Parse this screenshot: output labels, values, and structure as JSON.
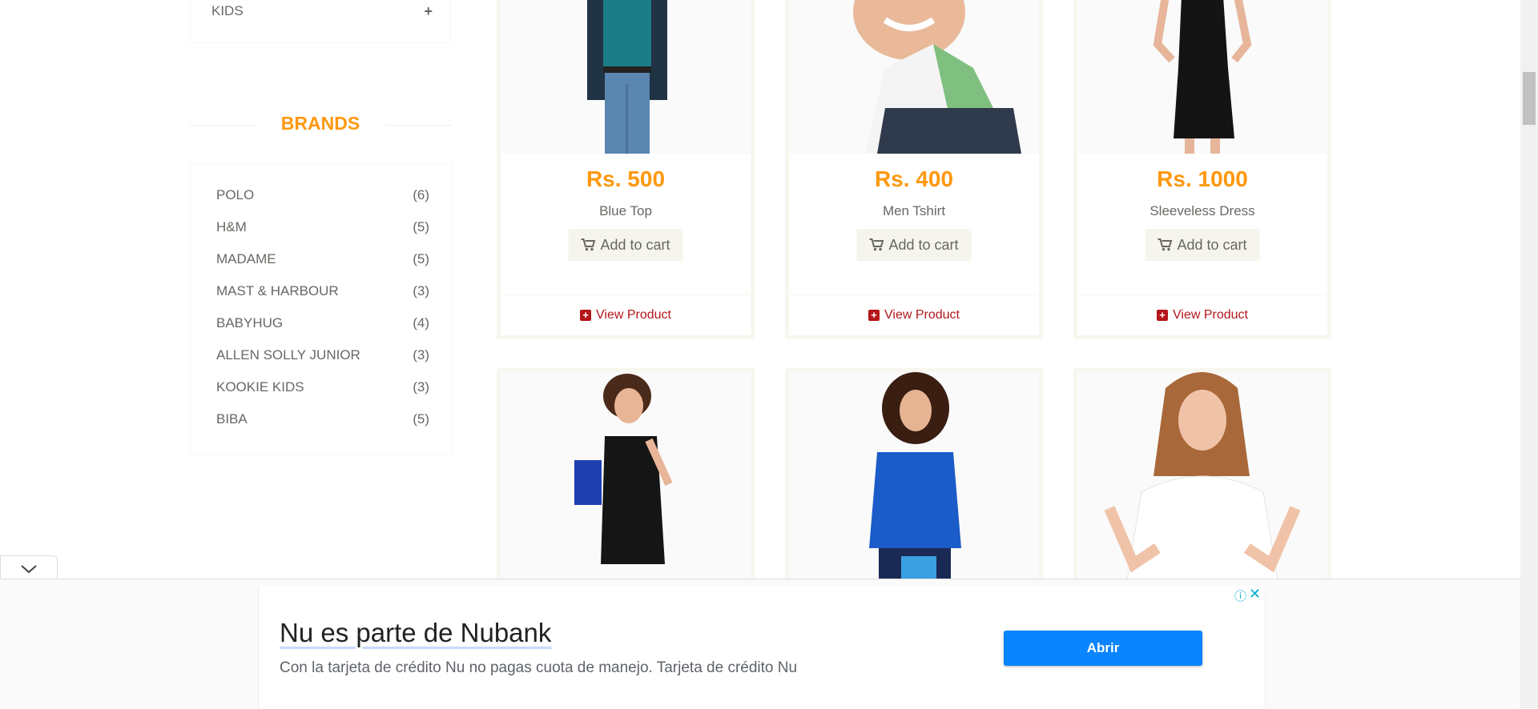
{
  "sidebar": {
    "category": {
      "label": "KIDS",
      "toggle": "+"
    },
    "brands_title": "BRANDS",
    "brands": [
      {
        "name": "POLO",
        "count": "(6)"
      },
      {
        "name": "H&M",
        "count": "(5)"
      },
      {
        "name": "MADAME",
        "count": "(5)"
      },
      {
        "name": "MAST & HARBOUR",
        "count": "(3)"
      },
      {
        "name": "BABYHUG",
        "count": "(4)"
      },
      {
        "name": "ALLEN SOLLY JUNIOR",
        "count": "(3)"
      },
      {
        "name": "KOOKIE KIDS",
        "count": "(3)"
      },
      {
        "name": "BIBA",
        "count": "(5)"
      }
    ]
  },
  "products": [
    {
      "price": "Rs. 500",
      "name": "Blue Top",
      "cart_label": "Add to cart",
      "view_label": "View Product"
    },
    {
      "price": "Rs. 400",
      "name": "Men Tshirt",
      "cart_label": "Add to cart",
      "view_label": "View Product"
    },
    {
      "price": "Rs. 1000",
      "name": "Sleeveless Dress",
      "cart_label": "Add to cart",
      "view_label": "View Product"
    }
  ],
  "ad": {
    "title": "Nu es parte de Nubank",
    "description": "Con la tarjeta de crédito Nu no pagas cuota de manejo. Tarjeta de crédito Nu",
    "button_label": "Abrir",
    "info_icon": "ⓘ",
    "close_icon": "✕"
  },
  "colors": {
    "accent": "#fe980f",
    "link": "#b4161b",
    "ad_button": "#0a84ff"
  }
}
